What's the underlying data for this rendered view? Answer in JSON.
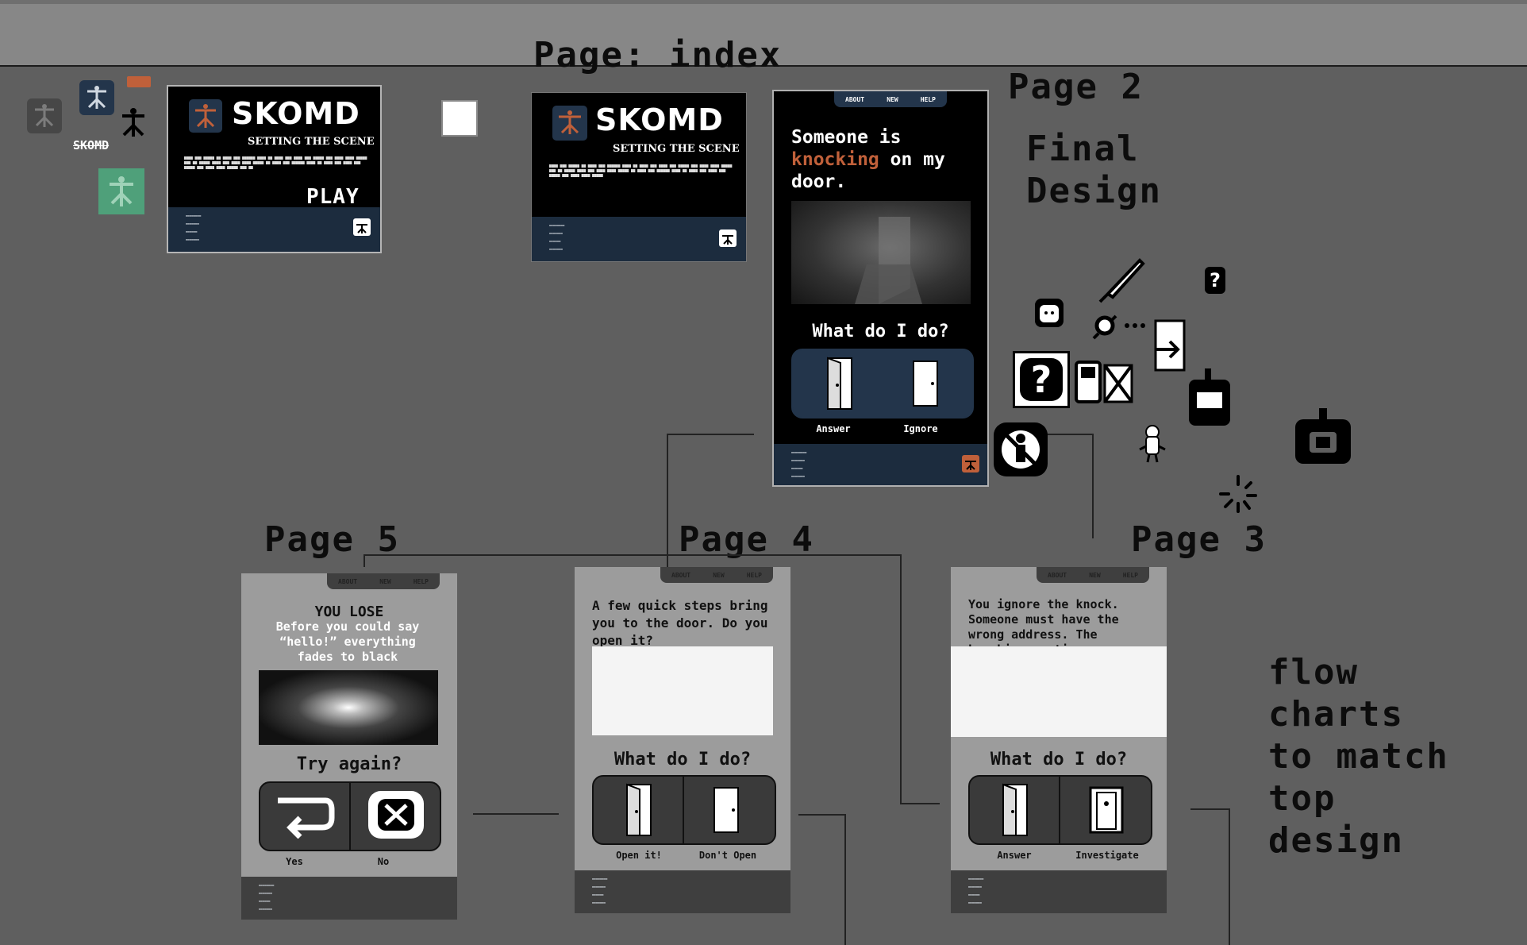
{
  "headings": {
    "index": "Page: index",
    "page2": "Page 2",
    "final": "Final\nDesign",
    "page5": "Page 5",
    "page4": "Page 4",
    "page3": "Page 3",
    "flow_note": "flow\ncharts\nto match\ntop\ndesign"
  },
  "colors": {
    "canvas": "#5f5f5f",
    "accent_orange": "#c0603a",
    "navy": "#1c2c3e",
    "green": "#4fa07a"
  },
  "brand": {
    "logo_text": "SKOMD",
    "small_logo_text": "SKOMD",
    "subtitle": "SETTING THE SCENE",
    "play": "PLAY"
  },
  "nav": {
    "about": "ABOUT",
    "new": "NEW",
    "help": "HELP"
  },
  "page2": {
    "line1": "Someone is",
    "highlight": "knocking",
    "line2_rest": " on my",
    "line3": "door.",
    "question": "What do I do?",
    "option_a": "Answer",
    "option_b": "Ignore"
  },
  "page3": {
    "story": "You ignore the knock. Someone must have the wrong address. The knocking continues.",
    "question": "What do I do?",
    "option_a": "Answer",
    "option_b": "Investigate"
  },
  "page4": {
    "story": "A few quick steps bring you to the door. Do you open it?",
    "question": "What do I do?",
    "option_a": "Open it!",
    "option_b": "Don't Open"
  },
  "page5": {
    "title": "YOU LOSE",
    "story": "Before you could say “hello!” everything fades to black",
    "question": "Try again?",
    "option_a": "Yes",
    "option_b": "No"
  },
  "icons": [
    "logo-icon",
    "door-open-icon",
    "door-closed-icon",
    "question-icon",
    "knife-icon",
    "key-icon",
    "phone-icon",
    "walkie-talkie-icon",
    "exit-door-icon",
    "ghost-icon",
    "return-arrow-icon",
    "close-x-icon",
    "no-person-icon"
  ]
}
